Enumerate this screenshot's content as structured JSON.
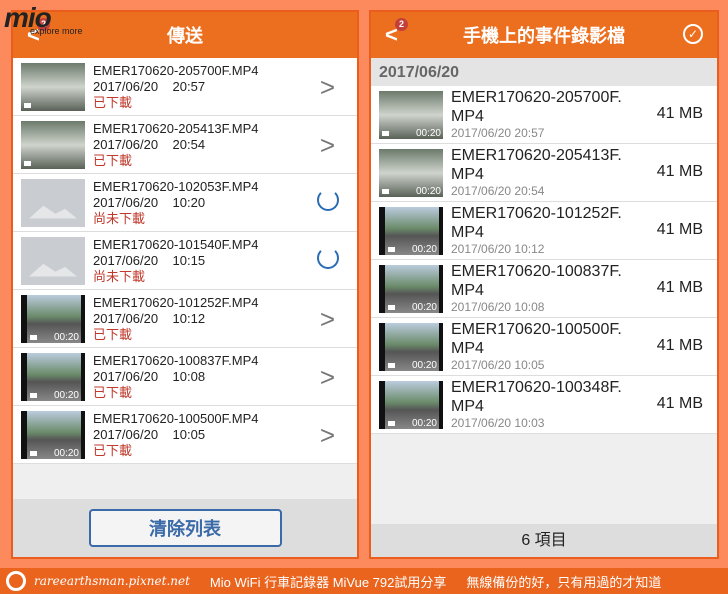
{
  "logo": {
    "brand": "Mio",
    "tagline": "explore more"
  },
  "left": {
    "title": "傳送",
    "badge": "2",
    "clear_button": "清除列表",
    "items": [
      {
        "name": "EMER170620-205700F.MP4",
        "date": "2017/06/20",
        "time": "20:57",
        "status": "已下載",
        "thumb": "s",
        "action": "chevron"
      },
      {
        "name": "EMER170620-205413F.MP4",
        "date": "2017/06/20",
        "time": "20:54",
        "status": "已下載",
        "thumb": "s",
        "action": "chevron"
      },
      {
        "name": "EMER170620-102053F.MP4",
        "date": "2017/06/20",
        "time": "10:20",
        "status": "尚未下載",
        "thumb": "g",
        "action": "refresh"
      },
      {
        "name": "EMER170620-101540F.MP4",
        "date": "2017/06/20",
        "time": "10:15",
        "status": "尚未下載",
        "thumb": "g",
        "action": "refresh"
      },
      {
        "name": "EMER170620-101252F.MP4",
        "date": "2017/06/20",
        "time": "10:12",
        "status": "已下載",
        "thumb": "v",
        "duration": "00:20",
        "action": "chevron"
      },
      {
        "name": "EMER170620-100837F.MP4",
        "date": "2017/06/20",
        "time": "10:08",
        "status": "已下載",
        "thumb": "v",
        "duration": "00:20",
        "action": "chevron"
      },
      {
        "name": "EMER170620-100500F.MP4",
        "date": "2017/06/20",
        "time": "10:05",
        "status": "已下載",
        "thumb": "v",
        "duration": "00:20",
        "action": "chevron"
      }
    ]
  },
  "right": {
    "title": "手機上的事件錄影檔",
    "badge": "2",
    "date_header": "2017/06/20",
    "count": "6 項目",
    "items": [
      {
        "name1": "EMER170620-205700F.",
        "name2": "MP4",
        "datetime": "2017/06/20  20:57",
        "size": "41 MB",
        "thumb": "s",
        "duration": "00:20"
      },
      {
        "name1": "EMER170620-205413F.",
        "name2": "MP4",
        "datetime": "2017/06/20  20:54",
        "size": "41 MB",
        "thumb": "s",
        "duration": "00:20"
      },
      {
        "name1": "EMER170620-101252F.",
        "name2": "MP4",
        "datetime": "2017/06/20  10:12",
        "size": "41 MB",
        "thumb": "v",
        "duration": "00:20"
      },
      {
        "name1": "EMER170620-100837F.",
        "name2": "MP4",
        "datetime": "2017/06/20  10:08",
        "size": "41 MB",
        "thumb": "v",
        "duration": "00:20"
      },
      {
        "name1": "EMER170620-100500F.",
        "name2": "MP4",
        "datetime": "2017/06/20  10:05",
        "size": "41 MB",
        "thumb": "v",
        "duration": "00:20"
      },
      {
        "name1": "EMER170620-100348F.",
        "name2": "MP4",
        "datetime": "2017/06/20  10:03",
        "size": "41 MB",
        "thumb": "v",
        "duration": "00:20"
      }
    ]
  },
  "banner": {
    "site": "rareearthsman.pixnet.net",
    "title": "Mio WiFi 行車記錄器 MiVue 792試用分享",
    "slogan": "無線備份的好，只有用過的才知道"
  }
}
